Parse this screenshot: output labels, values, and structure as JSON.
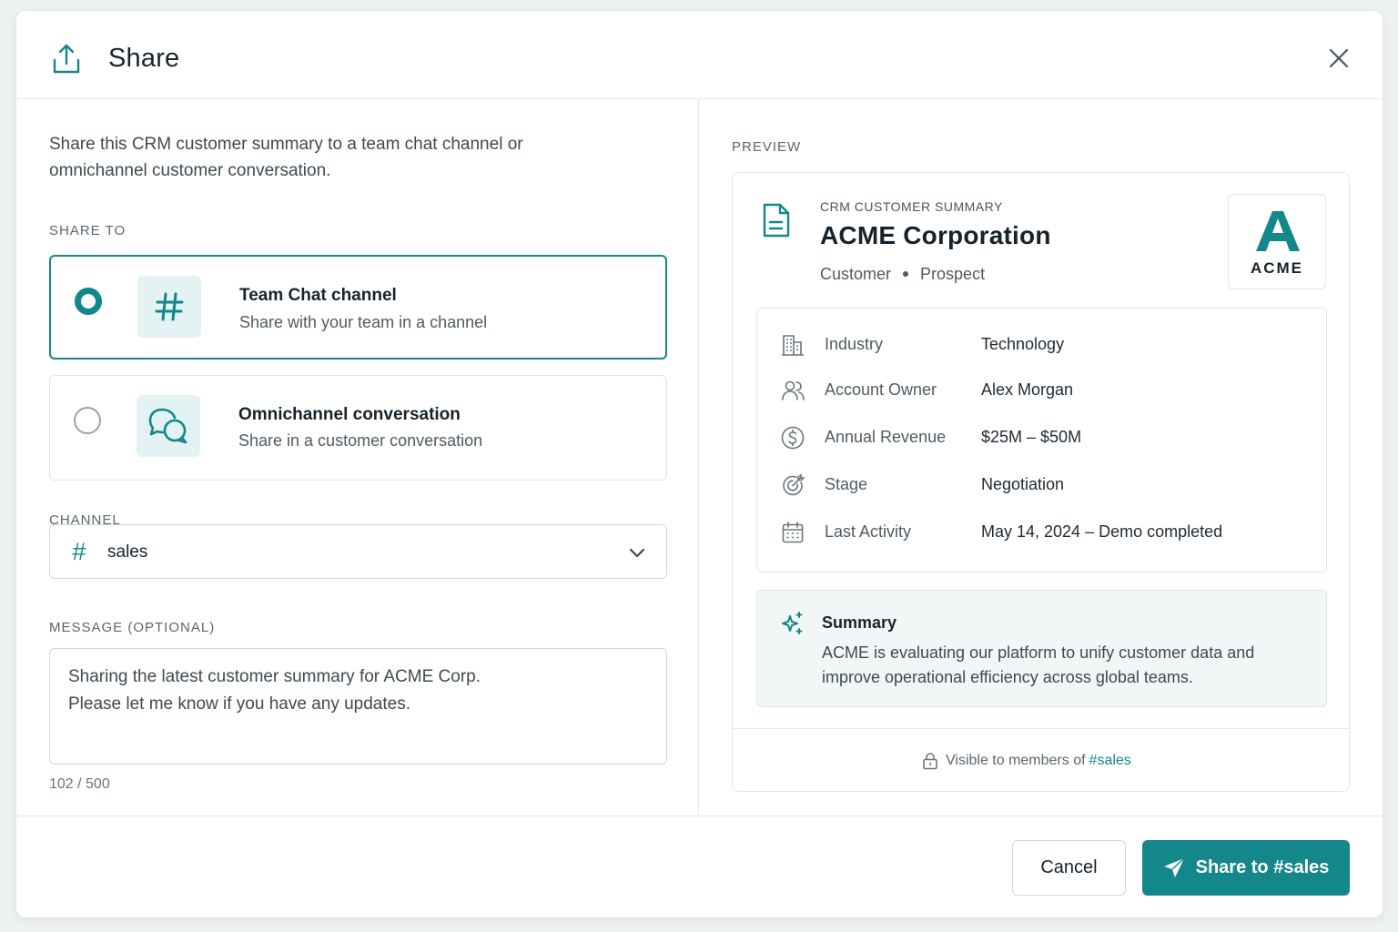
{
  "header": {
    "title": "Share"
  },
  "left": {
    "intro": "Share this CRM customer summary to a team chat channel or omnichannel customer conversation.",
    "share_to_label": "SHARE TO",
    "options": [
      {
        "title": "Team Chat channel",
        "subtitle": "Share with your team in a channel",
        "selected": true
      },
      {
        "title": "Omnichannel conversation",
        "subtitle": "Share in a customer conversation",
        "selected": false
      }
    ],
    "channel_label": "CHANNEL",
    "channel_hash": "#",
    "channel_value": "sales",
    "message_label": "MESSAGE (OPTIONAL)",
    "message_value": "Sharing the latest customer summary for ACME Corp.\nPlease let me know if you have any updates.",
    "counter": "102 / 500"
  },
  "preview": {
    "label": "PREVIEW",
    "eyebrow": "CRM CUSTOMER SUMMARY",
    "company": "ACME Corporation",
    "tags": [
      "Customer",
      "Prospect"
    ],
    "logo_text": "ACME",
    "fields": [
      {
        "icon": "building-icon",
        "label": "Industry",
        "value": "Technology"
      },
      {
        "icon": "users-icon",
        "label": "Account Owner",
        "value": "Alex Morgan"
      },
      {
        "icon": "dollar-icon",
        "label": "Annual Revenue",
        "value": "$25M – $50M"
      },
      {
        "icon": "target-icon",
        "label": "Stage",
        "value": "Negotiation"
      },
      {
        "icon": "calendar-icon",
        "label": "Last Activity",
        "value": "May 14, 2024 – Demo completed"
      }
    ],
    "summary_title": "Summary",
    "summary_text": "ACME is evaluating our platform to unify customer data and improve operational efficiency across global teams.",
    "visible_text": "Visible to members of",
    "visible_channel": "#sales"
  },
  "footer": {
    "cancel_label": "Cancel",
    "share_label": "Share to #sales"
  },
  "colors": {
    "accent": "#13878a",
    "accent_light": "#e3f2f2"
  }
}
